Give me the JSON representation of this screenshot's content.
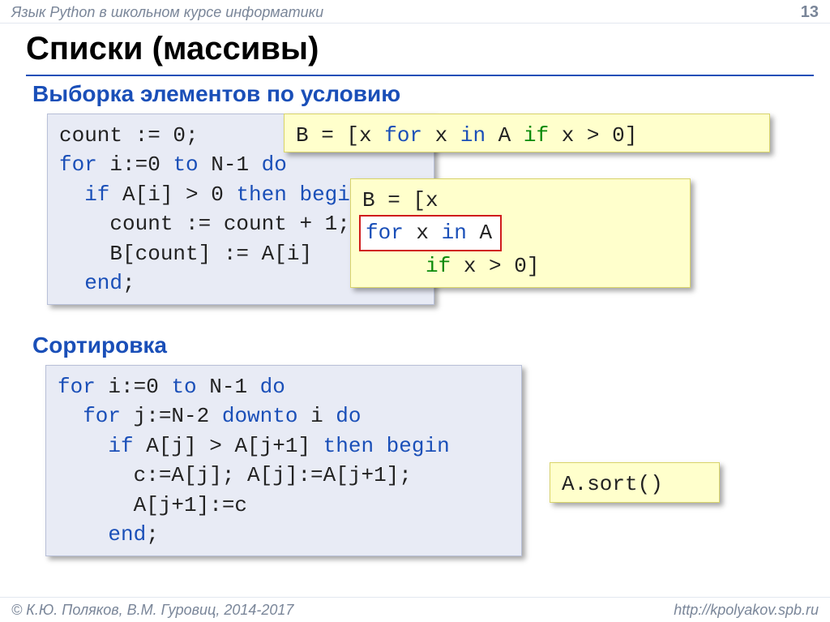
{
  "header": {
    "course": "Язык Python в школьном курсе информатики",
    "page": "13"
  },
  "title": "Списки (массивы)",
  "sections": {
    "filter": "Выборка элементов по условию",
    "sort": "Сортировка"
  },
  "pascal_filter": {
    "l1a": "count := 0;",
    "l2a": "for",
    "l2b": " i:=0 ",
    "l2c": "to",
    "l2d": " N-1 ",
    "l2e": "do",
    "l3a": "  if",
    "l3b": " A[i] > 0 ",
    "l3c": "then begin",
    "l4": "    count := count + 1;",
    "l5": "    B[count] := A[i]",
    "l6a": "  end",
    "l6b": ";"
  },
  "py_filter_one": {
    "a": "B = [x ",
    "b": "for",
    "c": " x ",
    "d": "in",
    "e": " A ",
    "f": "if",
    "g": " x > 0]"
  },
  "py_filter_multi": {
    "l1": "B = [x",
    "l2a": "for",
    "l2b": " x ",
    "l2c": "in",
    "l2d": " A",
    "l3a": "     if",
    "l3b": " x > 0]"
  },
  "pascal_sort": {
    "l1a": "for",
    "l1b": " i:=0 ",
    "l1c": "to",
    "l1d": " N-1 ",
    "l1e": "do",
    "l2a": "  for",
    "l2b": " j:=N-2 ",
    "l2c": "downto",
    "l2d": " i ",
    "l2e": "do",
    "l3a": "    if",
    "l3b": " A[j] > A[j+1] ",
    "l3c": "then begin",
    "l4": "      c:=A[j]; A[j]:=A[j+1];",
    "l5": "      A[j+1]:=c",
    "l6a": "    end",
    "l6b": ";"
  },
  "py_sort": "A.sort()",
  "footer": {
    "left": "© К.Ю. Поляков, В.М. Гуровиц, 2014-2017",
    "right": "http://kpolyakov.spb.ru"
  }
}
